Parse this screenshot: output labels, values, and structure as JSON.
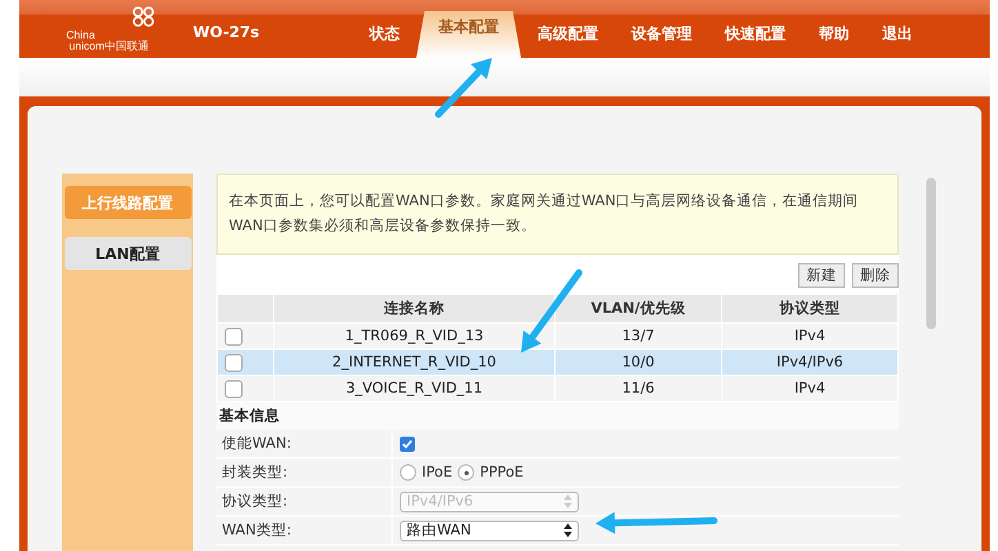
{
  "header": {
    "logo_text": [
      "China",
      "unicom中国联通"
    ],
    "model": "WO-27s",
    "nav": [
      {
        "label": "状态",
        "selected": false
      },
      {
        "label": "基本配置",
        "selected": true
      },
      {
        "label": "高级配置",
        "selected": false
      },
      {
        "label": "设备管理",
        "selected": false
      },
      {
        "label": "快速配置",
        "selected": false
      },
      {
        "label": "帮助",
        "selected": false
      },
      {
        "label": "退出",
        "selected": false
      }
    ]
  },
  "sidebar": {
    "items": [
      {
        "label": "上行线路配置",
        "selected": true
      },
      {
        "label": "LAN配置",
        "selected": false
      }
    ]
  },
  "info": "在本页面上，您可以配置WAN口参数。家庭网关通过WAN口与高层网络设备通信，在通信期间WAN口参数集必须和高层设备参数保持一致。",
  "buttons": [
    "新建",
    "删除"
  ],
  "table": {
    "columns": [
      "连接名称",
      "VLAN/优先级",
      "协议类型"
    ],
    "rows": [
      {
        "cells": [
          "1_TR069_R_VID_13",
          "13/7",
          "IPv4"
        ],
        "checked": false,
        "selected": false
      },
      {
        "cells": [
          "2_INTERNET_R_VID_10",
          "10/0",
          "IPv4/IPv6"
        ],
        "checked": false,
        "selected": true
      },
      {
        "cells": [
          "3_VOICE_R_VID_11",
          "11/6",
          "IPv4"
        ],
        "checked": false,
        "selected": false
      }
    ]
  },
  "section_title": "基本信息",
  "form": [
    {
      "kind": "checkbox",
      "label": "使能WAN:",
      "checked": true
    },
    {
      "kind": "radio",
      "label": "封装类型:",
      "options": [
        {
          "label": "IPoE",
          "selected": false
        },
        {
          "label": "PPPoE",
          "selected": true
        }
      ]
    },
    {
      "kind": "select",
      "label": "协议类型:",
      "value": "IPv4/IPv6",
      "disabled": true
    },
    {
      "kind": "select",
      "label": "WAN类型:",
      "value": "路由WAN",
      "disabled": false
    }
  ]
}
